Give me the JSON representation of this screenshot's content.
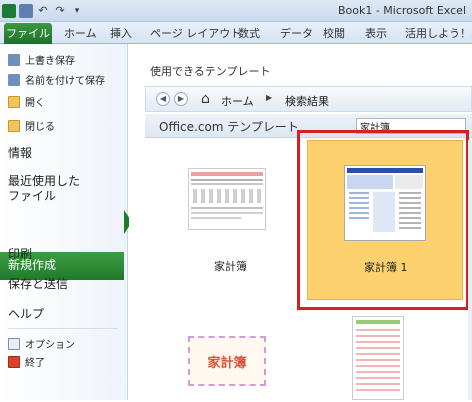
{
  "window": {
    "title": "Book1 - Microsoft Excel"
  },
  "ribbon": {
    "file_tab": "ファイル",
    "tabs": [
      "ホーム",
      "挿入",
      "ページ レイアウト",
      "数式",
      "データ",
      "校閲",
      "表示",
      "活用しよう！エク"
    ]
  },
  "backstage": {
    "commands_top": [
      "上書き保存",
      "名前を付けて保存",
      "開く",
      "閉じる"
    ],
    "info": "情報",
    "recent": [
      "最近使用した",
      "ファイル"
    ],
    "new": "新規作成",
    "print": "印刷",
    "save_send": "保存と送信",
    "help": "ヘルプ",
    "options": "オプション",
    "exit": "終了"
  },
  "main": {
    "section_title": "使用できるテンプレート",
    "breadcrumb": {
      "home": "ホーム",
      "result": "検索結果"
    },
    "officecom_label": "Office.com テンプレート",
    "search_value": "家計簿",
    "templates": [
      {
        "label": "家計簿"
      },
      {
        "label": "家計簿 1"
      },
      {
        "label": "家計簿"
      },
      {
        "label": ""
      }
    ]
  },
  "colors": {
    "file_tab": "#2e7d32",
    "selected_item": "#2e8b3a",
    "highlight_card": "#fdd16e",
    "annotation_box": "#d81e1e"
  }
}
